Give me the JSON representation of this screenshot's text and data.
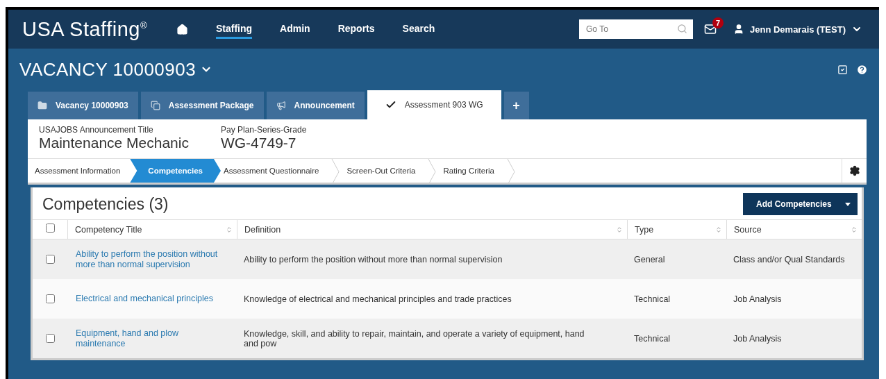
{
  "header": {
    "logo": "USA Staffing$^{®}$",
    "nav": [
      {
        "label": "Staffing",
        "selected": true
      },
      {
        "label": "Admin",
        "selected": false
      },
      {
        "label": "Reports",
        "selected": false
      },
      {
        "label": "Search",
        "selected": false
      }
    ],
    "search": {
      "placeholder": "Go To"
    },
    "mail_count": "7",
    "user": "Jenn Demarais (TEST)"
  },
  "vacancy": {
    "title": "VACANCY 10000903"
  },
  "tabs": [
    {
      "label": "Vacancy 10000903",
      "kind": "folder",
      "selected": false
    },
    {
      "label": "Assessment Package",
      "kind": "copy",
      "selected": false
    },
    {
      "label": "Announcement",
      "kind": "megaphone",
      "selected": false
    },
    {
      "label": "Assessment 903 WG",
      "kind": "check",
      "selected": true
    }
  ],
  "add_tab": "+",
  "info": [
    {
      "label": "USAJOBS Announcement Title",
      "value": "Maintenance Mechanic"
    },
    {
      "label": "Pay Plan-Series-Grade",
      "value": "WG-4749-7"
    }
  ],
  "steps": [
    {
      "label": "Assessment Information",
      "selected": false
    },
    {
      "label": "Competencies",
      "selected": true
    },
    {
      "label": "Assessment Questionnaire",
      "selected": false
    },
    {
      "label": "Screen-Out Criteria",
      "selected": false
    },
    {
      "label": "Rating Criteria",
      "selected": false
    }
  ],
  "table": {
    "title": "Competencies (3)",
    "add_button": "Add Competencies",
    "all_checked": false,
    "columns": [
      "Competency Title",
      "Definition",
      "Type",
      "Source"
    ],
    "rows": [
      {
        "checked": false,
        "title": "Ability to perform the position without more than normal supervision",
        "definition": "Ability to perform the position without more than normal supervision",
        "type": "General",
        "source": "Class and/or Qual Standards"
      },
      {
        "checked": false,
        "title": "Electrical and mechanical principles",
        "definition": "Knowledge of electrical and mechanical principles and trade practices",
        "type": "Technical",
        "source": "Job Analysis"
      },
      {
        "checked": false,
        "title": "Equipment, hand and plow maintenance",
        "definition": "Knowledge, skill, and ability to repair, maintain, and operate a variety of equipment, hand and pow",
        "type": "Technical",
        "source": "Job Analysis"
      }
    ]
  }
}
